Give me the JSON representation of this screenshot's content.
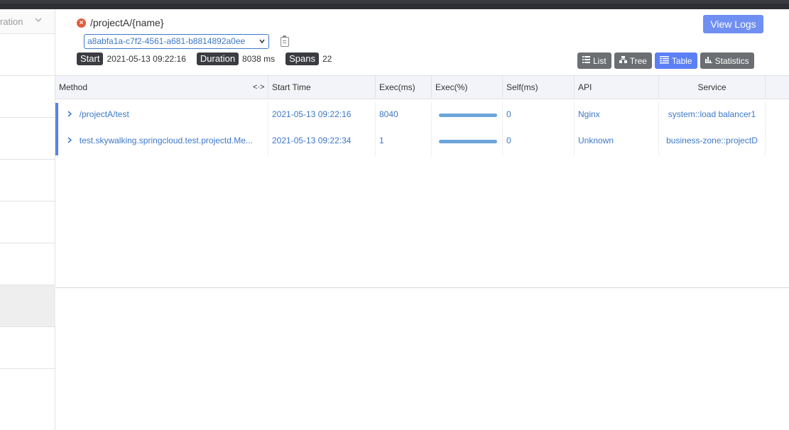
{
  "sidebar": {
    "filter_label": "ration"
  },
  "header": {
    "title": "/projectA/{name}",
    "trace_id": "a8abfa1a-c7f2-4561-a681-b8814892a0ee",
    "start_label": "Start",
    "start_value": "2021-05-13 09:22:16",
    "duration_label": "Duration",
    "duration_value": "8038 ms",
    "spans_label": "Spans",
    "spans_value": "22",
    "view_logs": "View Logs"
  },
  "views": [
    {
      "label": "List",
      "icon": "list-icon",
      "active": false
    },
    {
      "label": "Tree",
      "icon": "tree-icon",
      "active": false
    },
    {
      "label": "Table",
      "icon": "table-icon",
      "active": true
    },
    {
      "label": "Statistics",
      "icon": "statistics-icon",
      "active": false
    }
  ],
  "table": {
    "columns": [
      "Method",
      "Start Time",
      "Exec(ms)",
      "Exec(%)",
      "Self(ms)",
      "API",
      "Service"
    ],
    "resize_glyph": "<·>",
    "rows": [
      {
        "method": "/projectA/test",
        "start": "2021-05-13 09:22:16",
        "exec": "8040",
        "exec_pct": 1.0,
        "self": "0",
        "api": "Nginx",
        "service": "system::load balancer1"
      },
      {
        "method": "test.skywalking.springcloud.test.projectd.Me...",
        "start": "2021-05-13 09:22:34",
        "exec": "1",
        "exec_pct": 1.0,
        "self": "0",
        "api": "Unknown",
        "service": "business-zone::projectD"
      }
    ]
  },
  "colors": {
    "accent": "#5b80f6",
    "link": "#3d78c9",
    "error": "#e05d3d",
    "exec_bar": "#6ba5da"
  }
}
